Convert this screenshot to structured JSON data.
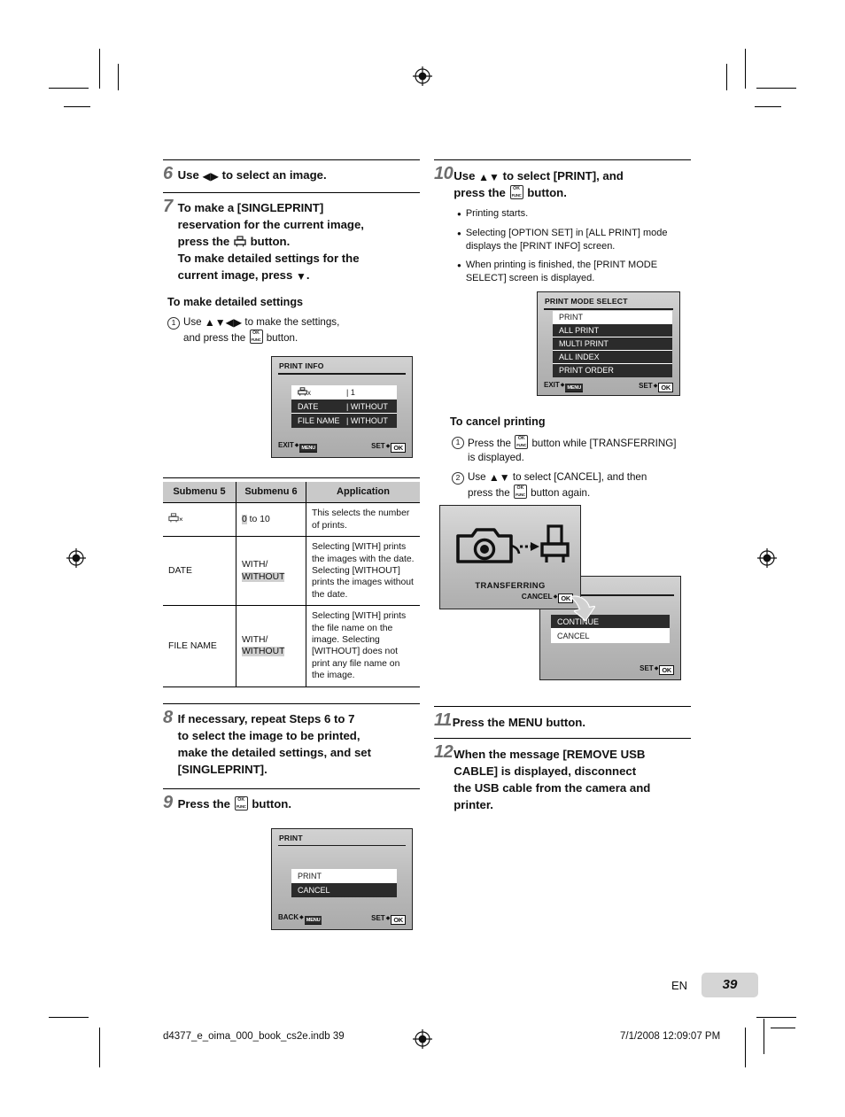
{
  "page": {
    "language_code": "EN",
    "page_number": "39",
    "footer_file": "d4377_e_oima_000_book_cs2e.indb   39",
    "footer_date": "7/1/2008   12:09:07 PM"
  },
  "left_column": {
    "step6": {
      "number": "6",
      "text_before": "Use",
      "text_after": "to select an image."
    },
    "step7": {
      "number": "7",
      "line1": "To make a [SINGLEPRINT]",
      "line2": "reservation for the current image,",
      "line3_before": "press the",
      "line3_after": "button.",
      "line4": "To make detailed settings for the",
      "line5_before": "current image, press",
      "line5_after": ".",
      "subhead": "To make detailed settings",
      "sub1_num": "1",
      "sub1_before": "Use",
      "sub1_mid": "to make the settings,",
      "sub1_after2": "and press the",
      "sub1_end": "button."
    },
    "print_info_screen": {
      "title": "PRINT INFO",
      "rows": [
        {
          "label": "⎓x",
          "value": "| 1",
          "selected": true
        },
        {
          "label": "DATE",
          "value": "| WITHOUT",
          "selected": false
        },
        {
          "label": "FILE NAME",
          "value": "| WITHOUT",
          "selected": false
        }
      ],
      "foot_left_label": "EXIT",
      "foot_left_tag": "MENU",
      "foot_right_label": "SET",
      "foot_right_tag": "OK"
    },
    "table": {
      "headers": [
        "Submenu 5",
        "Submenu 6",
        "Application"
      ],
      "rows": [
        {
          "submenu5": "⎓x",
          "submenu5_is_icon": true,
          "submenu6_highlight": "0",
          "submenu6_rest": " to 10",
          "application": "This selects the number of prints."
        },
        {
          "submenu5": "DATE",
          "submenu5_is_icon": false,
          "submenu6_plain": "WITH/",
          "submenu6_highlight2": "WITHOUT",
          "application": "Selecting [WITH] prints the images with the date. Selecting [WITHOUT] prints the images without the date."
        },
        {
          "submenu5": "FILE NAME",
          "submenu5_is_icon": false,
          "submenu6_plain": "WITH/",
          "submenu6_highlight2": "WITHOUT",
          "application": "Selecting [WITH] prints the file name on the image. Selecting [WITHOUT] does not print any file name on the image."
        }
      ]
    },
    "step8": {
      "number": "8",
      "line1": "If necessary, repeat Steps 6 to 7",
      "line2": "to select the image to be printed,",
      "line3": "make the detailed settings, and set",
      "line4": "[SINGLEPRINT]."
    },
    "step9": {
      "number": "9",
      "text_before": "Press the",
      "text_after": "button."
    },
    "print_screen": {
      "title": "PRINT",
      "rows": [
        {
          "label": "PRINT",
          "selected": true
        },
        {
          "label": "CANCEL",
          "selected": false
        }
      ],
      "foot_left_label": "BACK",
      "foot_left_tag": "MENU",
      "foot_right_label": "SET",
      "foot_right_tag": "OK"
    }
  },
  "right_column": {
    "step10": {
      "number": "10",
      "line1_before": "Use",
      "line1_after": "to select [PRINT], and",
      "line2_before": "press the",
      "line2_after": "button.",
      "bullets": [
        "Printing starts.",
        "Selecting [OPTION SET] in [ALL PRINT] mode displays the [PRINT INFO] screen.",
        "When printing is finished, the [PRINT MODE SELECT] screen is displayed."
      ]
    },
    "print_mode_select_screen": {
      "title": "PRINT MODE SELECT",
      "rows": [
        {
          "label": "PRINT",
          "selected": true
        },
        {
          "label": "ALL PRINT",
          "selected": false
        },
        {
          "label": "MULTI PRINT",
          "selected": false
        },
        {
          "label": "ALL INDEX",
          "selected": false
        },
        {
          "label": "PRINT ORDER",
          "selected": false
        }
      ],
      "foot_left_label": "EXIT",
      "foot_left_tag": "MENU",
      "foot_right_label": "SET",
      "foot_right_tag": "OK"
    },
    "cancel_printing": {
      "subhead": "To cancel printing",
      "sub1_num": "1",
      "sub1_before": "Press the",
      "sub1_mid": "button while [TRANSFERRING]",
      "sub1_line2": "is displayed.",
      "sub2_num": "2",
      "sub2_before": "Use",
      "sub2_mid": "to select [CANCEL], and then",
      "sub2_line2_before": "press the",
      "sub2_line2_after": "button again."
    },
    "transferring_screen": {
      "status_text": "TRANSFERRING",
      "foot_label": "CANCEL",
      "foot_tag": "OK"
    },
    "continue_cancel_screen": {
      "rows": [
        {
          "label": "CONTINUE",
          "selected": false
        },
        {
          "label": "CANCEL",
          "selected": true
        }
      ],
      "foot_right_label": "SET",
      "foot_right_tag": "OK"
    },
    "step11": {
      "number": "11",
      "text_before": "Press the",
      "text_menu": "MENU",
      "text_after": "button."
    },
    "step12": {
      "number": "12",
      "line1": "When the message [REMOVE USB",
      "line2": "CABLE] is displayed, disconnect",
      "line3": "the USB cable from the camera and",
      "line4": "printer."
    }
  }
}
